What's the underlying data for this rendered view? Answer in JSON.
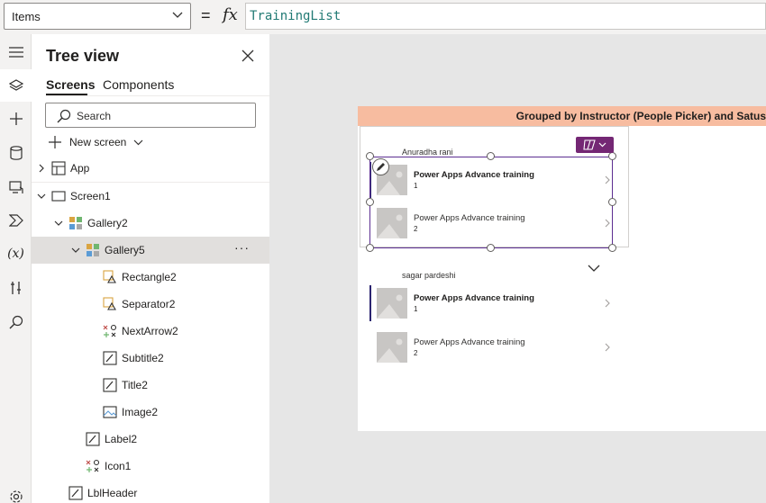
{
  "formula_bar": {
    "property": "Items",
    "equals": "=",
    "fx": "fx",
    "formula": "TrainingList"
  },
  "tree_view": {
    "title": "Tree view",
    "tabs": [
      "Screens",
      "Components"
    ],
    "search_placeholder": "Search",
    "new_screen_label": "New screen",
    "nodes": [
      {
        "label": "App"
      },
      {
        "label": "Screen1"
      },
      {
        "label": "Gallery2"
      },
      {
        "label": "Gallery5",
        "more": "···"
      },
      {
        "label": "Rectangle2"
      },
      {
        "label": "Separator2"
      },
      {
        "label": "NextArrow2"
      },
      {
        "label": "Subtitle2"
      },
      {
        "label": "Title2"
      },
      {
        "label": "Image2"
      },
      {
        "label": "Label2"
      },
      {
        "label": "Icon1"
      },
      {
        "label": "LblHeader"
      }
    ]
  },
  "canvas": {
    "header": "Grouped by Instructor (People Picker) and Satus",
    "groups": [
      {
        "instructor": "Anuradha rani",
        "items": [
          {
            "title": "Power Apps Advance training",
            "subtitle": "1"
          },
          {
            "title": "Power Apps Advance training",
            "subtitle": "2"
          }
        ]
      },
      {
        "instructor": "sagar pardeshi",
        "items": [
          {
            "title": "Power Apps Advance training",
            "subtitle": "1"
          },
          {
            "title": "Power Apps Advance training",
            "subtitle": "2"
          }
        ]
      }
    ]
  },
  "colors": {
    "header_bg": "#f7bca0",
    "selection": "#5c2e91",
    "copilot": "#742774",
    "formula_text": "#217a74"
  },
  "icons": {
    "rail": [
      "hamburger-icon",
      "layers-icon",
      "plus-icon",
      "database-icon",
      "media-icon",
      "power-automate-icon",
      "variables-icon",
      "tools-icon",
      "search-icon",
      "settings-icon"
    ]
  }
}
